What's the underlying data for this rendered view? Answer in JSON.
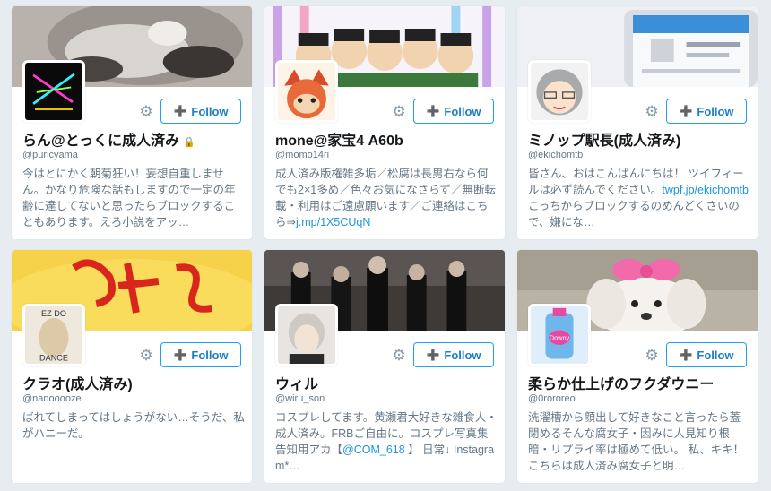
{
  "cards": [
    {
      "name": "らん@とっくに成人済み",
      "handle": "@puricyama",
      "bio": "今はとにかく朝菊狂い！妄想自重しません。かなり危険な話もしますので一定の年齢に達してないと思ったらブロックすることもあります。えろ小説をアッ…",
      "bio_link": "",
      "bio_after": "",
      "protected": true,
      "follow_label": "Follow",
      "icons": {
        "settings": "gear-icon",
        "follow": "person-plus-icon",
        "lock": "lock-icon"
      }
    },
    {
      "name": "mone@家宝4 A60b",
      "handle": "@momo14ri",
      "bio": "成人済み版権雑多垢／松腐は長男右なら何でも2×1多め／色々お気になさらず／無断転載・利用はご遠慮願います／ご連絡はこちら⇒",
      "bio_link": "j.mp/1X5CUqN",
      "bio_after": "",
      "protected": false,
      "follow_label": "Follow"
    },
    {
      "name": "ミノップ駅長(成人済み)",
      "handle": "@ekichomtb",
      "bio": "皆さん、おはこんばんにちは！ ツイフィールは必ず読んでください。",
      "bio_link": "twpf.jp/ekichomtb",
      "bio_after": " こっちからブロックするのめんどくさいので、嫌にな…",
      "protected": false,
      "follow_label": "Follow"
    },
    {
      "name": "クラオ(成人済み)",
      "handle": "@nanooooze",
      "bio": "ばれてしまってはしょうがない…そうだ、私がハニーだ。",
      "bio_link": "",
      "bio_after": "",
      "protected": false,
      "follow_label": "Follow",
      "avatar_text": [
        "EZ DO",
        "DANCE"
      ]
    },
    {
      "name": "ウィル",
      "handle": "@wiru_son",
      "bio": "コスプレしてます。黄瀬君大好きな雑食人・成人済み。FRBご自由に。コスプレ写真集告知用アカ【",
      "bio_link": "@COM_618",
      "bio_after": " 】 日常↓ Instagram*…",
      "protected": false,
      "follow_label": "Follow"
    },
    {
      "name": "柔らか仕上げのフクダウニー",
      "handle": "@0rororeo",
      "bio": "洗濯槽から顔出して好きなこと言ったら蓋閉めるそんな腐女子・因みに人見知り根暗・リプライ率は極めて低い。 私、キキ！こちらは成人済み腐女子と明…",
      "bio_link": "",
      "bio_after": "",
      "protected": false,
      "follow_label": "Follow",
      "avatar_text": [
        "Downy"
      ]
    }
  ],
  "colors": {
    "accent": "#1da1f2",
    "background": "#e6ecf0",
    "name": "#14171a",
    "muted": "#657786"
  }
}
